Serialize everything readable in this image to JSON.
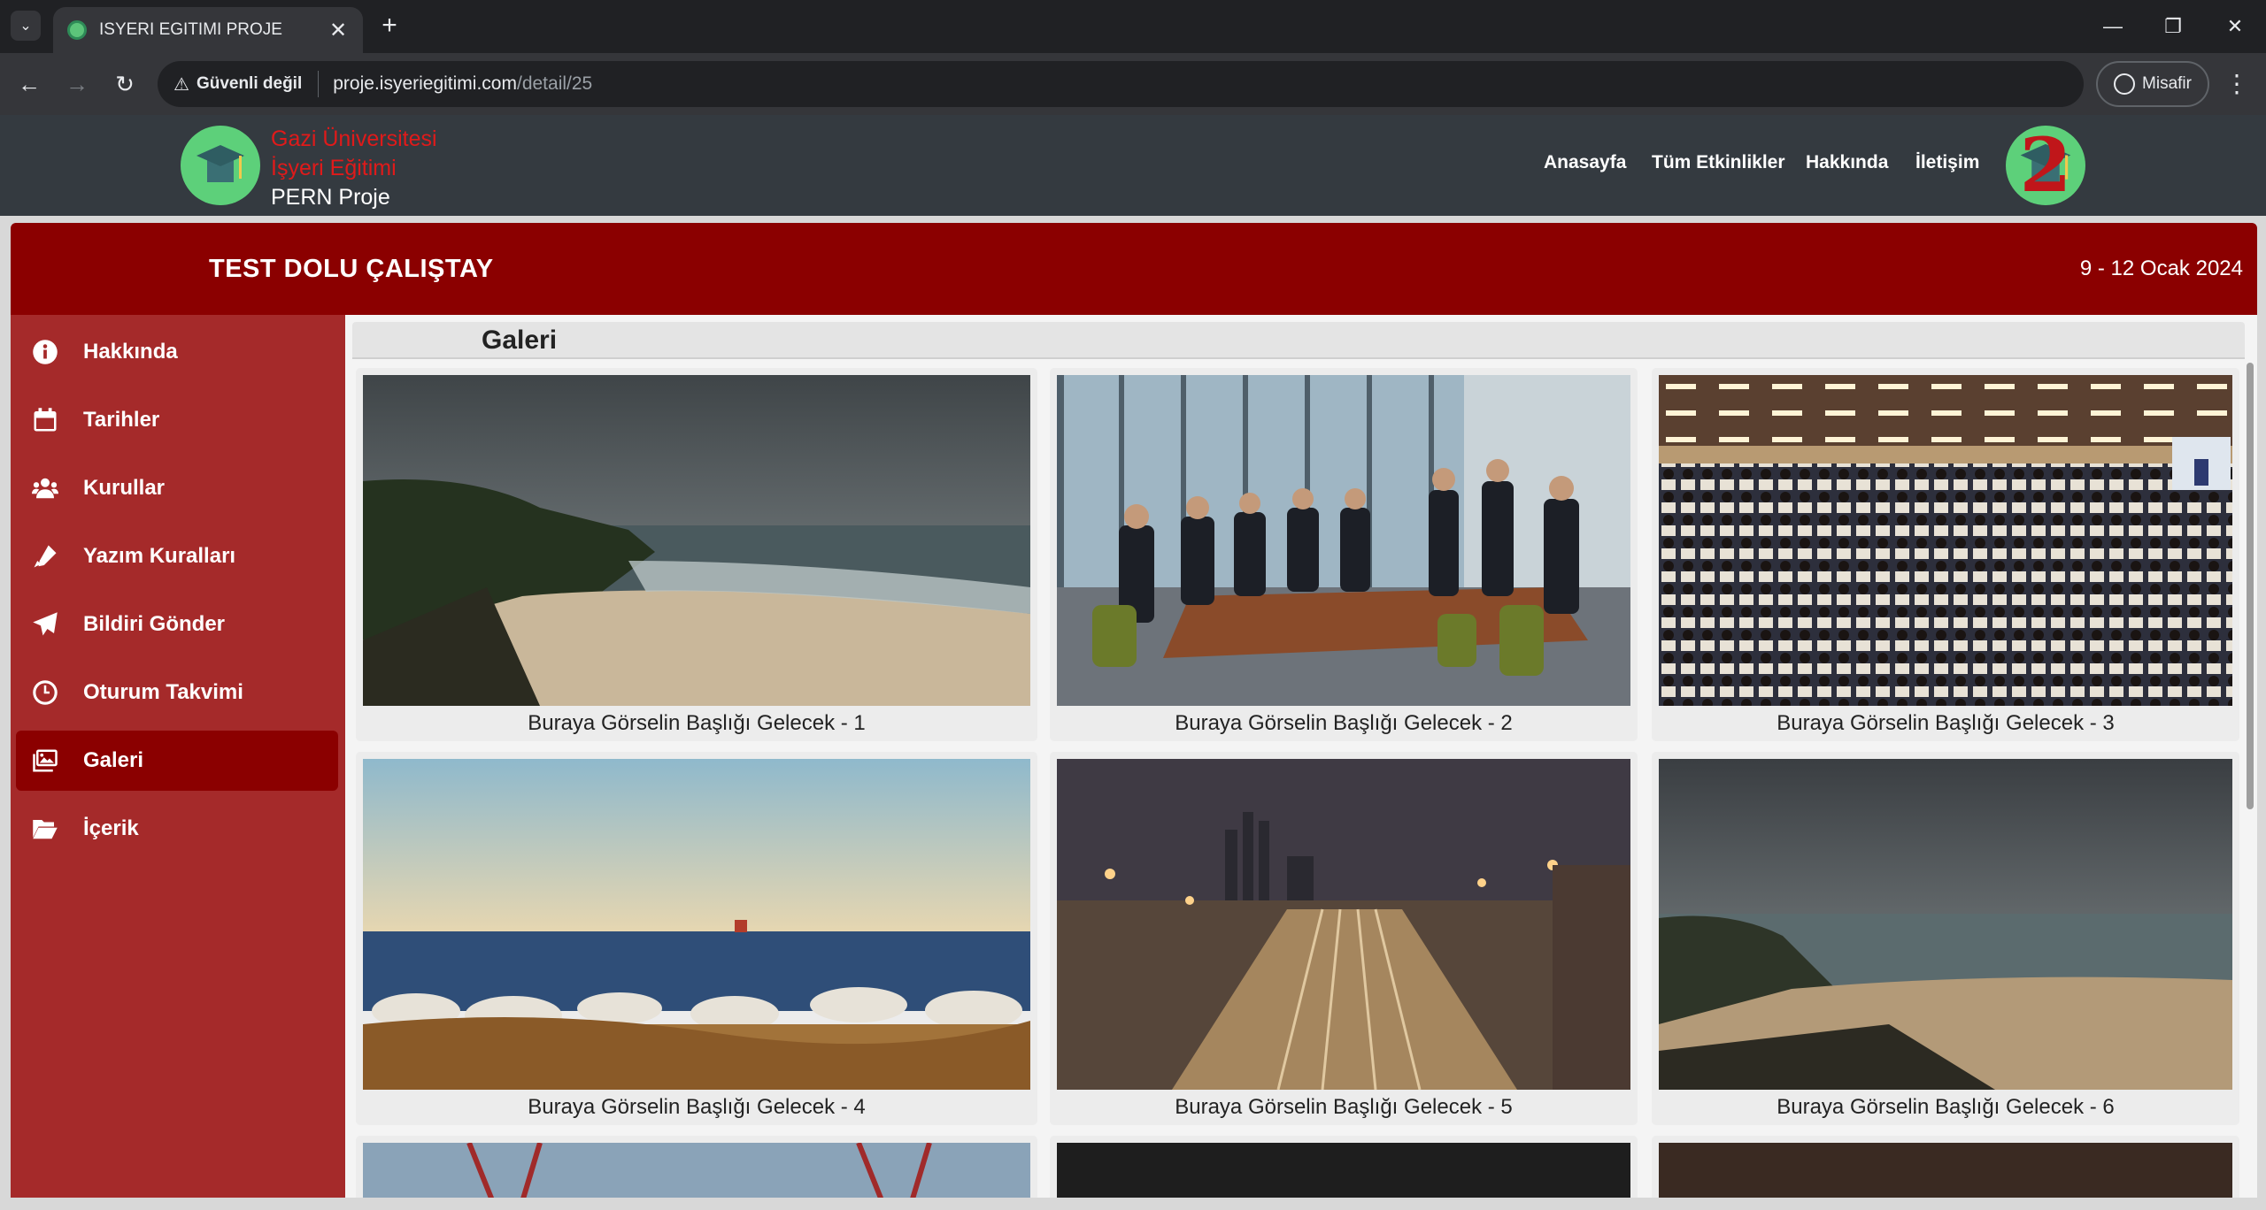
{
  "browser": {
    "tab_title": "ISYERI EGITIMI PROJE",
    "tab_close": "✕",
    "new_tab": "+",
    "security_label": "Güvenli değil",
    "url_host": "proje.isyeriegitimi.com",
    "url_path": "/detail/25",
    "profile_label": "Misafir",
    "window_minimize": "—",
    "window_restore": "❐",
    "window_close": "✕"
  },
  "header": {
    "brand_line1": "Gazi Üniversitesi",
    "brand_line2": "İşyeri Eğitimi",
    "brand_line3": "PERN Proje",
    "menu": [
      "Anasayfa",
      "Tüm Etkinlikler",
      "Hakkında",
      "İletişim"
    ],
    "badge_text": "2"
  },
  "event": {
    "title": "TEST DOLU ÇALIŞTAY",
    "date": "9 - 12 Ocak 2024"
  },
  "sidebar": {
    "items": [
      {
        "label": "Hakkında",
        "icon": "info-icon",
        "active": false
      },
      {
        "label": "Tarihler",
        "icon": "calendar-icon",
        "active": false
      },
      {
        "label": "Kurullar",
        "icon": "users-icon",
        "active": false
      },
      {
        "label": "Yazım Kuralları",
        "icon": "pen-icon",
        "active": false
      },
      {
        "label": "Bildiri Gönder",
        "icon": "paper-plane-icon",
        "active": false
      },
      {
        "label": "Oturum Takvimi",
        "icon": "clock-icon",
        "active": false
      },
      {
        "label": "Galeri",
        "icon": "images-icon",
        "active": true
      },
      {
        "label": "İçerik",
        "icon": "folder-open-icon",
        "active": false
      }
    ]
  },
  "gallery": {
    "heading": "Galeri",
    "items": [
      {
        "caption": "Buraya Görselin Başlığı Gelecek - 1",
        "scene": "stormy-beach-cliff"
      },
      {
        "caption": "Buraya Görselin Başlığı Gelecek - 2",
        "scene": "business-meeting-room"
      },
      {
        "caption": "Buraya Görselin Başlığı Gelecek - 3",
        "scene": "conference-audience"
      },
      {
        "caption": "Buraya Görselin Başlığı Gelecek - 4",
        "scene": "sea-rocks-lighthouse"
      },
      {
        "caption": "Buraya Görselin Başlığı Gelecek - 5",
        "scene": "railway-at-night"
      },
      {
        "caption": "Buraya Görselin Başlığı Gelecek - 6",
        "scene": "cloudy-shoreline"
      }
    ]
  },
  "colors": {
    "banner": "#8b0000",
    "sidebar": "#a52a2a",
    "active_item": "#8b0000",
    "header": "#343a40",
    "brand_red": "#e01a1a"
  }
}
